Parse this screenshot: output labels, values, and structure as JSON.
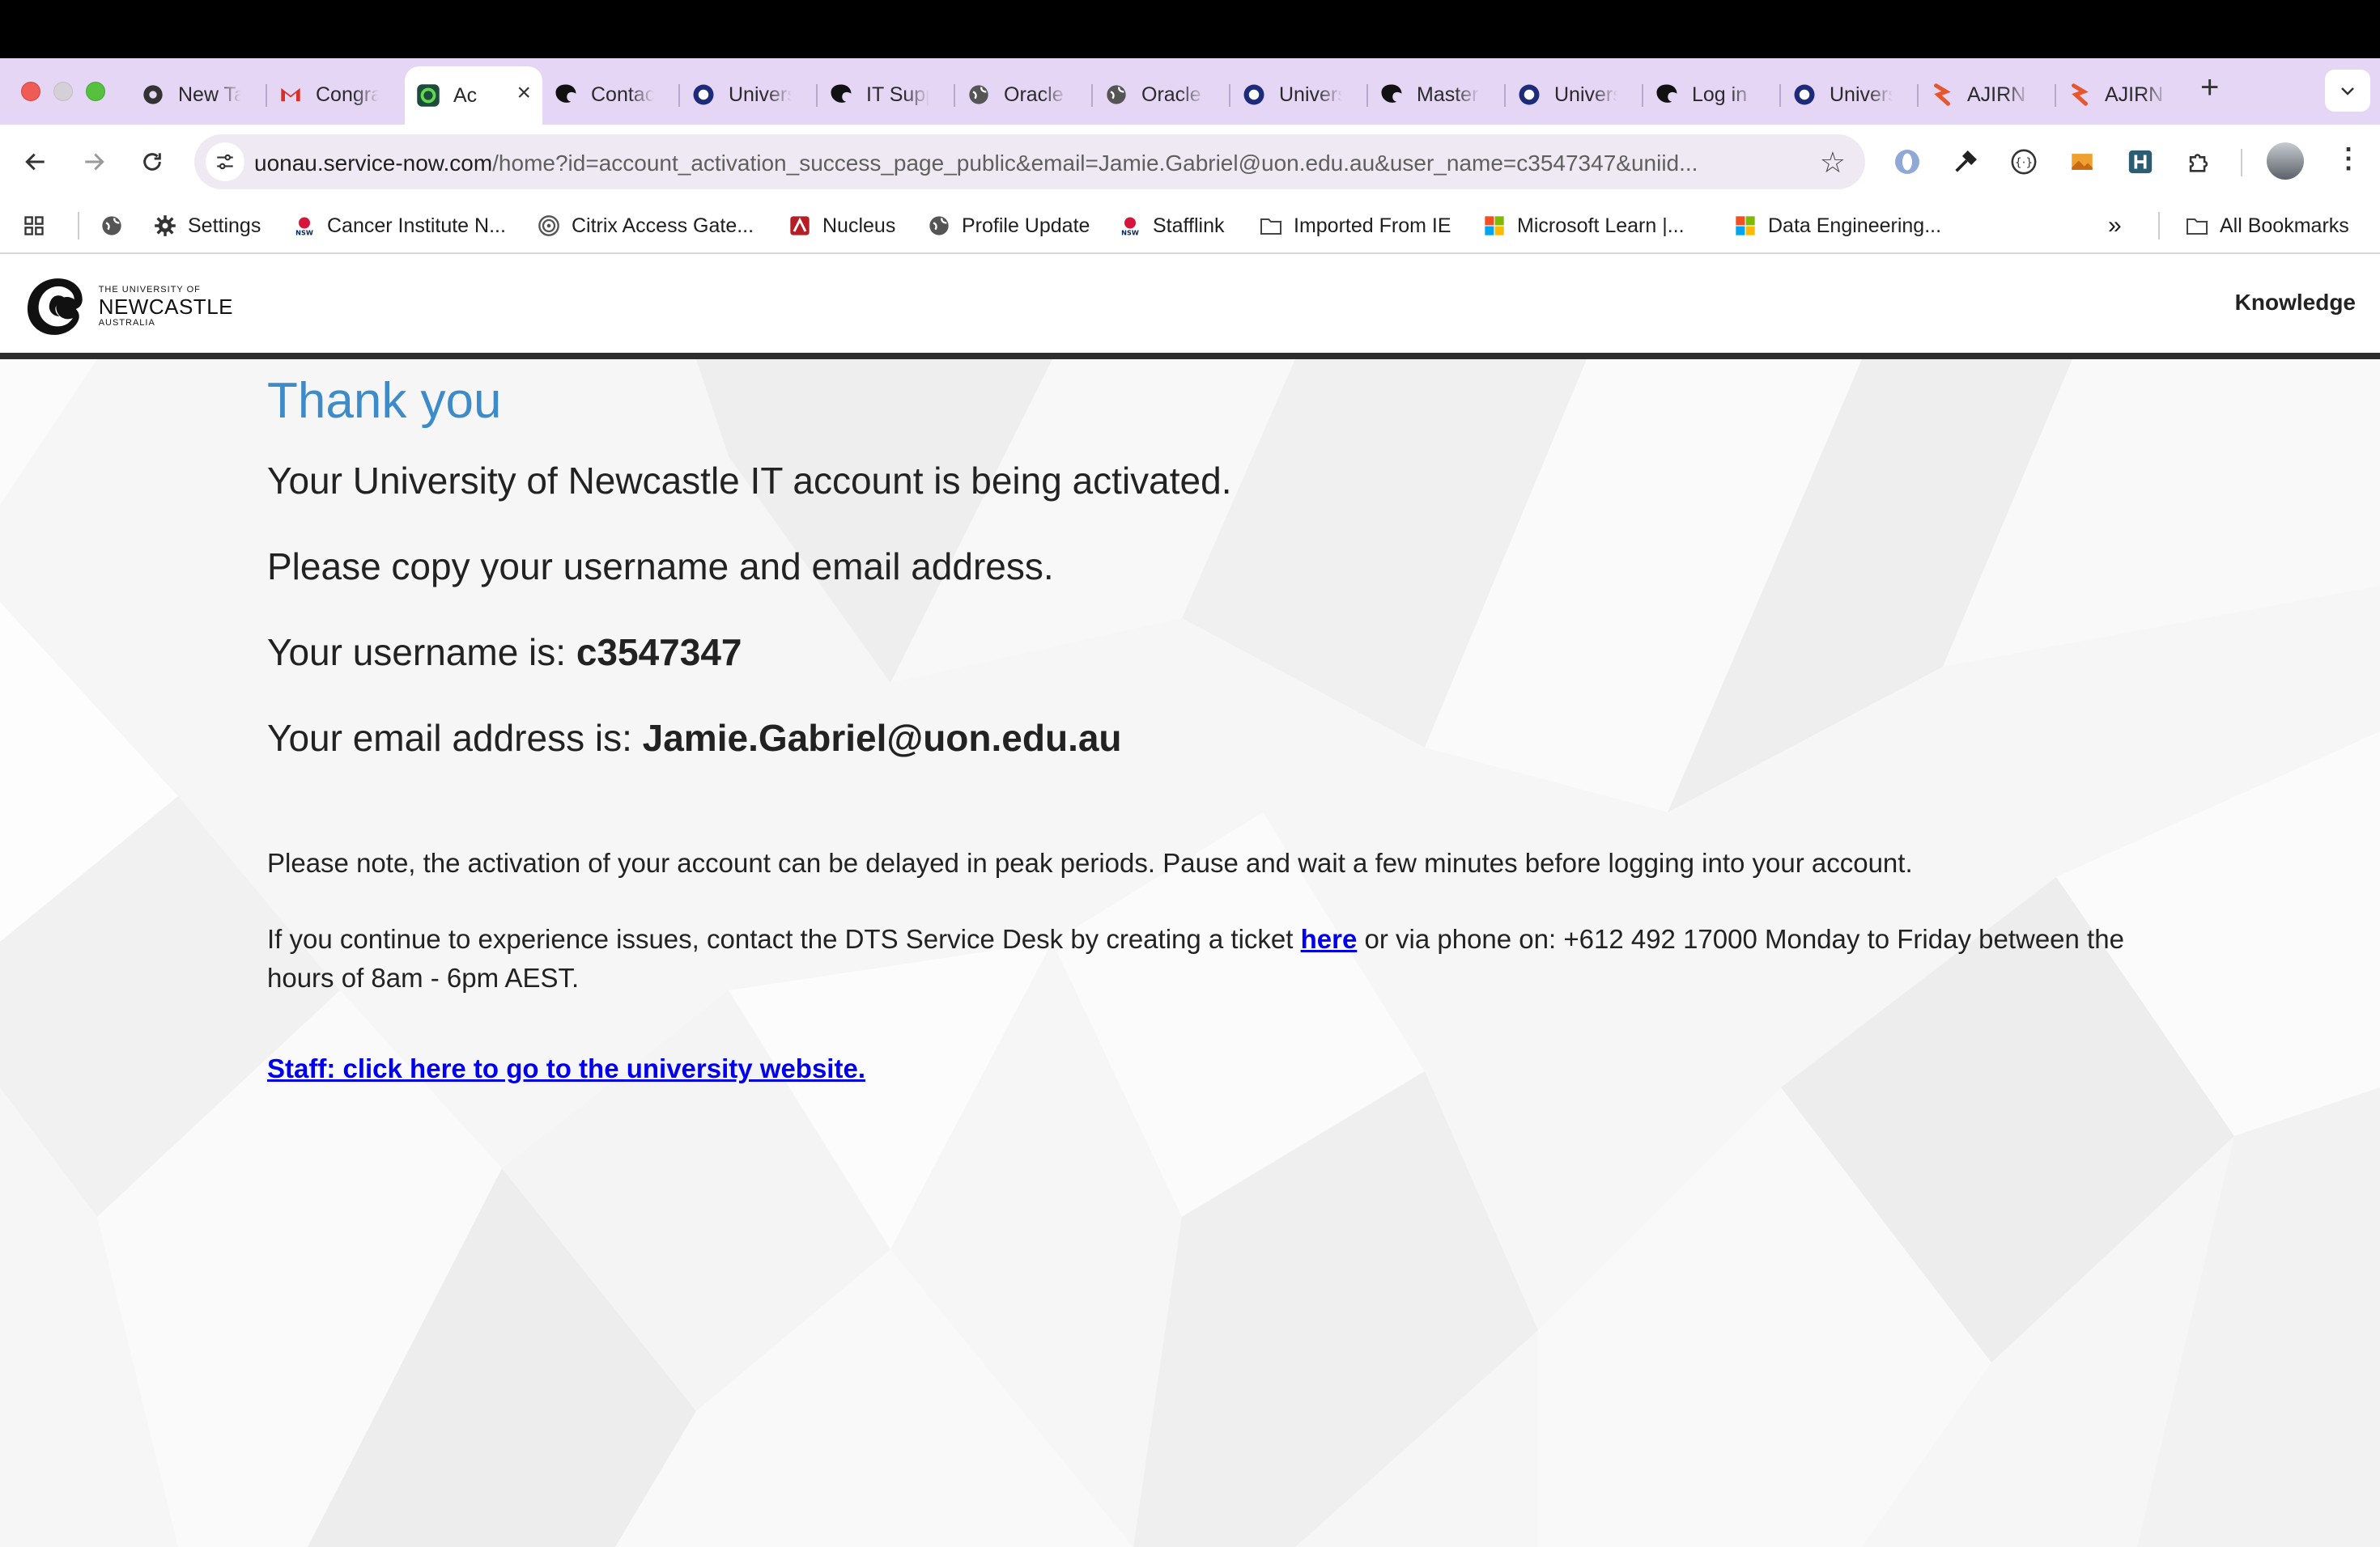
{
  "browser": {
    "tabs": [
      {
        "title": "New Tab",
        "icon": "chrome-icon"
      },
      {
        "title": "Congratulations",
        "icon": "gmail-icon"
      },
      {
        "title": "Ac",
        "icon": "servicenow-icon",
        "active": true
      },
      {
        "title": "Contact",
        "icon": "newcastle-icon"
      },
      {
        "title": "University",
        "icon": "circle-o-icon"
      },
      {
        "title": "IT Support",
        "icon": "newcastle-icon"
      },
      {
        "title": "Oracle",
        "icon": "globe-icon"
      },
      {
        "title": "Oracle",
        "icon": "globe-icon"
      },
      {
        "title": "University",
        "icon": "circle-o-icon"
      },
      {
        "title": "Master",
        "icon": "newcastle-icon"
      },
      {
        "title": "University",
        "icon": "circle-o-icon"
      },
      {
        "title": "Log in",
        "icon": "newcastle-icon"
      },
      {
        "title": "University",
        "icon": "circle-o-icon"
      },
      {
        "title": "AJIRN",
        "icon": "ajirn-icon"
      },
      {
        "title": "AJIRN",
        "icon": "ajirn-icon"
      }
    ],
    "new_tab_label": "+",
    "url_host": "uonau.service-now.com",
    "url_path": "/home?id=account_activation_success_page_public&email=Jamie.Gabriel@uon.edu.au&user_name=c3547347&uniid...",
    "bookmarks": [
      {
        "label": "",
        "icon": "apps-grid-icon"
      },
      {
        "label": "",
        "icon": "globe-icon"
      },
      {
        "label": "Settings",
        "icon": "gear-icon"
      },
      {
        "label": "Cancer Institute N...",
        "icon": "nsw-icon"
      },
      {
        "label": "Citrix Access Gate...",
        "icon": "citrix-icon"
      },
      {
        "label": "Nucleus",
        "icon": "nucleus-icon"
      },
      {
        "label": "Profile Update",
        "icon": "globe-icon"
      },
      {
        "label": "Stafflink",
        "icon": "nsw-icon"
      },
      {
        "label": "Imported From IE",
        "icon": "folder-icon"
      },
      {
        "label": "Microsoft Learn |...",
        "icon": "microsoft-icon"
      },
      {
        "label": "Data Engineering...",
        "icon": "microsoft-icon"
      }
    ],
    "more_bookmarks": "»",
    "all_bookmarks": "All Bookmarks"
  },
  "site": {
    "logo": {
      "line1": "THE UNIVERSITY OF",
      "line2": "NEWCASTLE",
      "line3": "AUSTRALIA"
    },
    "nav_knowledge": "Knowledge"
  },
  "content": {
    "heading": "Thank you",
    "line1": "Your University of Newcastle IT account is being activated.",
    "line2": "Please copy your username and email address.",
    "username_label": "Your username is: ",
    "username": "c3547347",
    "email_label": "Your email address is: ",
    "email": "Jamie.Gabriel@uon.edu.au",
    "note": "Please note, the activation of your account can be delayed in peak periods. Pause and wait a few minutes before logging into your account.",
    "issue_before": "If you continue to experience issues, contact the DTS Service Desk by creating a ticket ",
    "issue_link": "here",
    "issue_after": " or via phone on: +612 492 17000 Monday to Friday between the hours of 8am - 6pm AEST.",
    "staff_link": "Staff: click here to go to the university website."
  },
  "colors": {
    "tabstrip": "#e5d6f5",
    "heading": "#3d8cc9",
    "link": "#0000ee"
  }
}
